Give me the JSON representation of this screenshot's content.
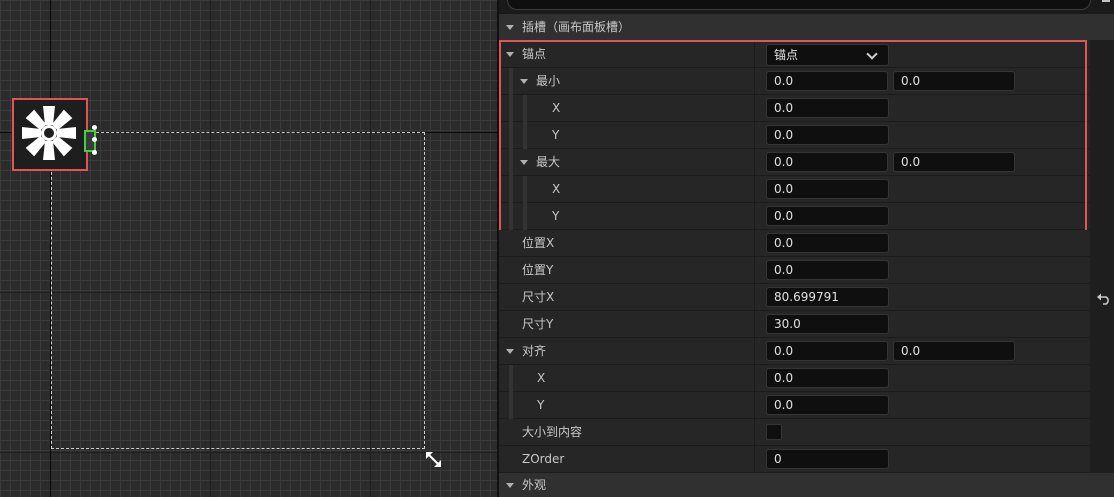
{
  "details": {
    "slot_category": "插槽（画布面板槽）",
    "anchors": {
      "label": "锚点",
      "value": "锚点",
      "minimum": {
        "label": "最小",
        "x_value": "0.0",
        "y_value": "0.0",
        "x_label": "X",
        "y_label": "Y"
      },
      "maximum": {
        "label": "最大",
        "x_value": "0.0",
        "y_value": "0.0",
        "x_label": "X",
        "y_label": "Y"
      }
    },
    "position_x": {
      "label": "位置X",
      "value": "0.0"
    },
    "position_y": {
      "label": "位置Y",
      "value": "0.0"
    },
    "size_x": {
      "label": "尺寸X",
      "value": "80.699791"
    },
    "size_y": {
      "label": "尺寸Y",
      "value": "30.0"
    },
    "alignment": {
      "label": "对齐",
      "x_value": "0.0",
      "y_value": "0.0",
      "x_label": "X",
      "y_label": "Y"
    },
    "size_to_content": {
      "label": "大小到内容",
      "checked": false
    },
    "zorder": {
      "label": "ZOrder",
      "value": "0"
    },
    "appearance_category": "外观"
  },
  "colors": {
    "highlight": "#e05555",
    "selection_handle": "#3fd23f",
    "panel_background": "#242424",
    "field_background": "#0f0f0f"
  },
  "icons": [
    "anchor-flower-icon",
    "resize-arrow-icon",
    "reset-to-default-icon",
    "expand-arrow-icon",
    "chevron-down-icon"
  ]
}
